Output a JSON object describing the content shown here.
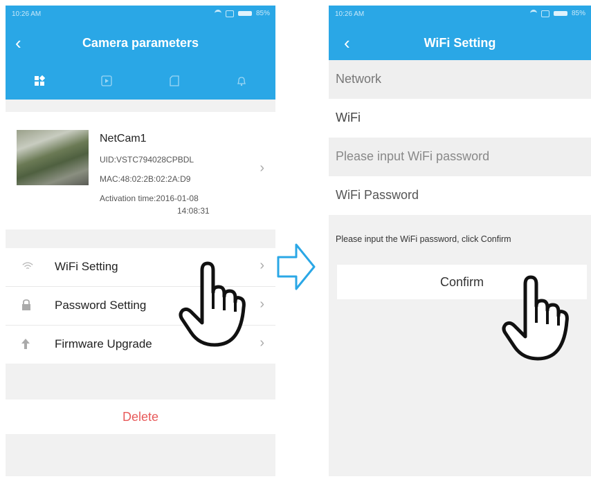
{
  "left": {
    "status": {
      "time": "10:26 AM",
      "battery": "85%"
    },
    "title": "Camera parameters",
    "tabs": [
      "apps-icon",
      "video-icon",
      "sdcard-icon",
      "bell-icon"
    ],
    "device": {
      "name": "NetCam1",
      "uid": "UID:VSTC794028CPBDL",
      "mac": "MAC:48:02:2B:02:2A:D9",
      "activation": "Activation time:2016-01-08",
      "activation_time": "14:08:31"
    },
    "menu": [
      {
        "label": "WiFi Setting",
        "icon": "wifi-icon"
      },
      {
        "label": "Password Setting",
        "icon": "lock-icon"
      },
      {
        "label": "Firmware Upgrade",
        "icon": "upload-arrow-icon"
      }
    ],
    "delete_label": "Delete"
  },
  "right": {
    "status": {
      "time": "10:26 AM",
      "battery": "85%"
    },
    "title": "WiFi Setting",
    "network_label": "Network",
    "wifi_value": "WiFi",
    "password_placeholder": "Please input WiFi password",
    "password_label": "WiFi Password",
    "hint": "Please input the WiFi password, click Confirm",
    "confirm_label": "Confirm"
  },
  "colors": {
    "header": "#2aa7e6",
    "delete": "#e85a5a",
    "arrow": "#2aa7e6"
  }
}
